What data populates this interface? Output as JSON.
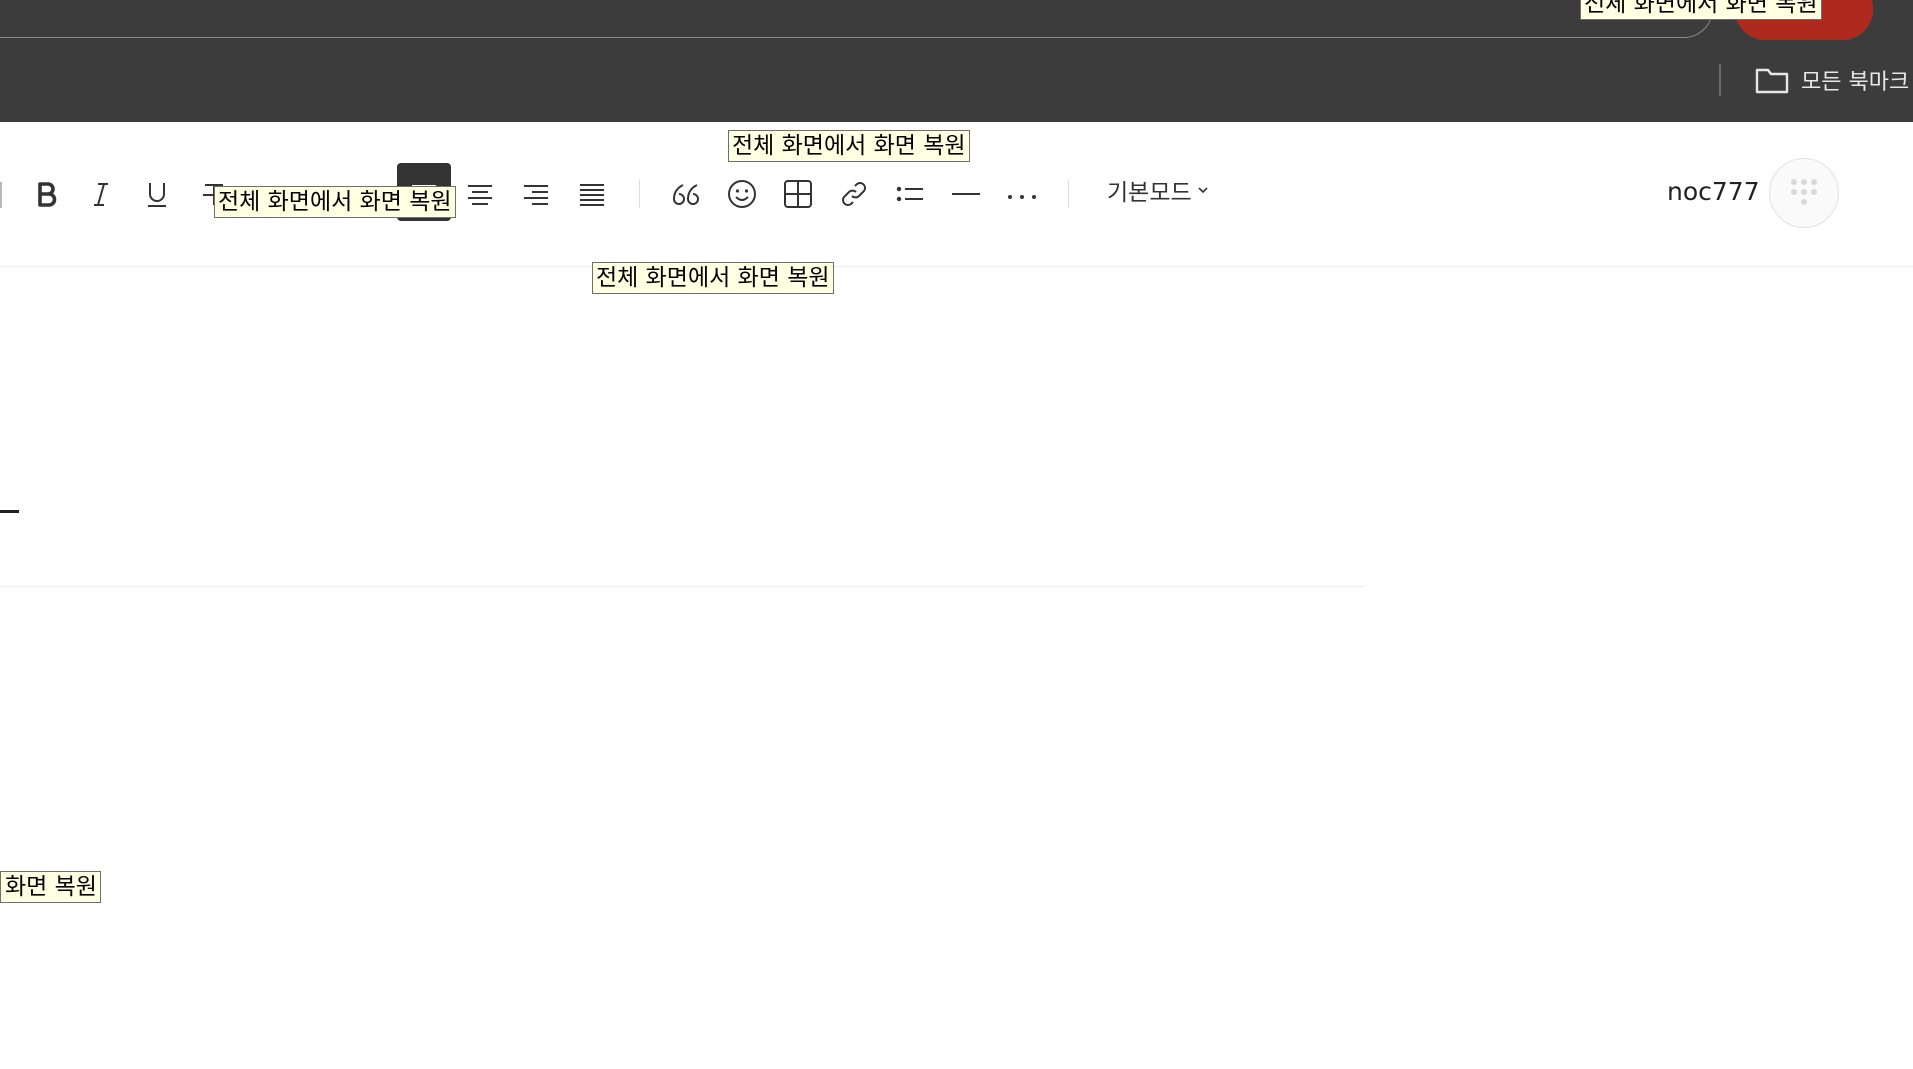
{
  "browser": {
    "bookmarks_folder_label": "모든 북마크",
    "folder_icon": "folder-icon"
  },
  "toolbar": {
    "buttons": [
      {
        "name": "bold-button",
        "icon": "bold-icon"
      },
      {
        "name": "italic-button",
        "icon": "italic-icon"
      },
      {
        "name": "underline-button",
        "icon": "underline-icon"
      },
      {
        "name": "strikethrough-button",
        "icon": "strikethrough-icon"
      },
      {
        "name": "align-left-button",
        "icon": "align-left-icon",
        "active": true
      },
      {
        "name": "align-center-button",
        "icon": "align-center-icon"
      },
      {
        "name": "align-right-button",
        "icon": "align-right-icon"
      },
      {
        "name": "align-justify-button",
        "icon": "align-justify-icon"
      },
      {
        "name": "quote-button",
        "icon": "quote-icon"
      },
      {
        "name": "emoji-button",
        "icon": "smiley-icon"
      },
      {
        "name": "table-button",
        "icon": "table-icon"
      },
      {
        "name": "link-button",
        "icon": "link-icon"
      },
      {
        "name": "list-button",
        "icon": "bulleted-list-icon"
      },
      {
        "name": "horizontal-rule-button",
        "icon": "horizontal-line-icon"
      },
      {
        "name": "more-button",
        "icon": "ellipsis-icon"
      }
    ],
    "mode_label": "기본모드",
    "username": "noc777"
  },
  "tooltips": {
    "text": "전체 화면에서 화면 복원",
    "partial_text": "화면 복원"
  },
  "colors": {
    "chrome_bg": "#3c3c3c",
    "profile_red": "#b0291f",
    "tooltip_bg": "#ffffe1",
    "active_button": "#333333"
  }
}
